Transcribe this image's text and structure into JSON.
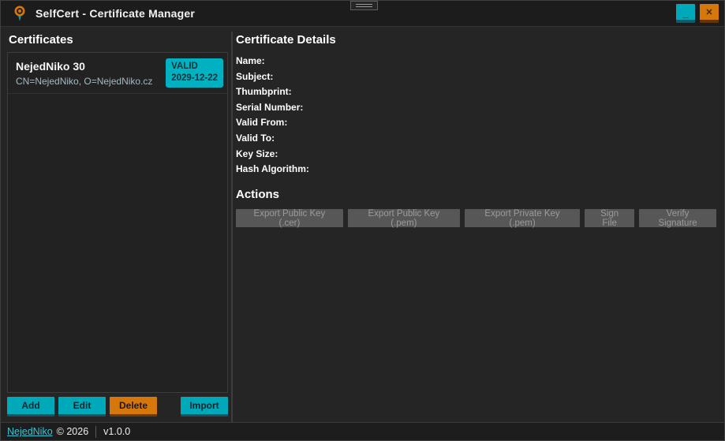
{
  "window": {
    "title": "SelfCert - Certificate Manager",
    "icons": {
      "minimize_glyph": "_",
      "close_glyph": "✕"
    }
  },
  "left_panel": {
    "heading": "Certificates",
    "certificates": [
      {
        "name": "NejedNiko 30",
        "subject": "CN=NejedNiko, O=NejedNiko.cz",
        "status": "VALID",
        "expiry": "2029-12-22"
      }
    ],
    "buttons": {
      "add": "Add",
      "edit": "Edit",
      "delete": "Delete",
      "import": "Import"
    }
  },
  "details_panel": {
    "heading": "Certificate Details",
    "fields": [
      {
        "label": "Name:",
        "value": ""
      },
      {
        "label": "Subject:",
        "value": ""
      },
      {
        "label": "Thumbprint:",
        "value": ""
      },
      {
        "label": "Serial Number:",
        "value": ""
      },
      {
        "label": "Valid From:",
        "value": ""
      },
      {
        "label": "Valid To:",
        "value": ""
      },
      {
        "label": "Key Size:",
        "value": ""
      },
      {
        "label": "Hash Algorithm:",
        "value": ""
      }
    ],
    "actions_heading": "Actions",
    "action_buttons": [
      "Export Public Key (.cer)",
      "Export Public Key (.pem)",
      "Export Private Key (.pem)",
      "Sign File",
      "Verify Signature"
    ]
  },
  "footer": {
    "link": "NejedNiko",
    "copyright": "© 2026",
    "version": "v1.0.0"
  },
  "colors": {
    "accent_cyan": "#00a9ba",
    "accent_orange": "#d6770b",
    "badge_cyan": "#00b1c1",
    "link_cyan": "#3fc0cf",
    "titlebar_bg": "#1c1c1c",
    "content_bg": "#252526"
  }
}
